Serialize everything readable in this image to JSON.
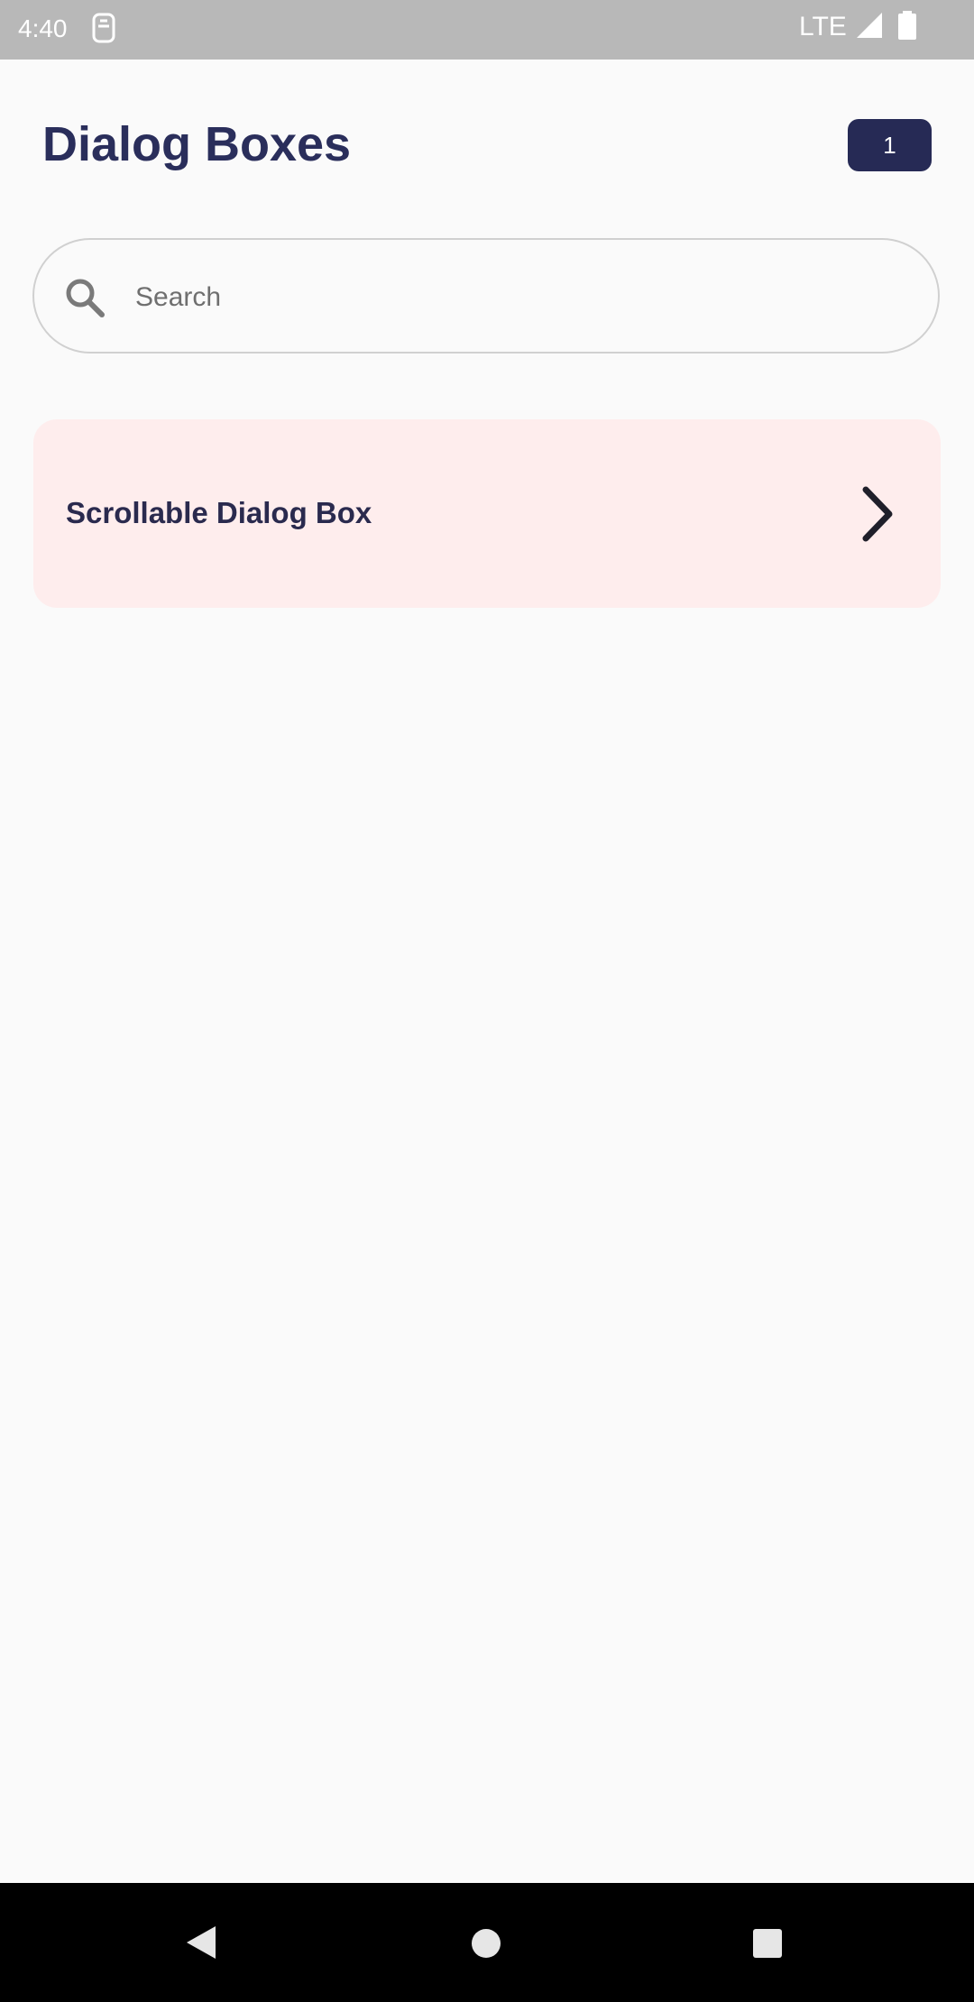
{
  "status_bar": {
    "time": "4:40",
    "network": "LTE",
    "icons": [
      "sim-icon",
      "signal-icon",
      "battery-icon"
    ]
  },
  "header": {
    "title": "Dialog Boxes",
    "badge_count": "1"
  },
  "search": {
    "placeholder": "Search",
    "value": ""
  },
  "list": {
    "items": [
      {
        "label": "Scrollable Dialog Box",
        "icon": "chevron-right-icon"
      }
    ]
  },
  "nav_bar": {
    "icons": [
      "back-icon",
      "home-icon",
      "recents-icon"
    ]
  },
  "colors": {
    "status_bar": "#b8b8b8",
    "background": "#fafafa",
    "title": "#2a2e5b",
    "badge_bg": "#262a55",
    "card_bg": "#feeded",
    "nav_bar": "#000000"
  }
}
